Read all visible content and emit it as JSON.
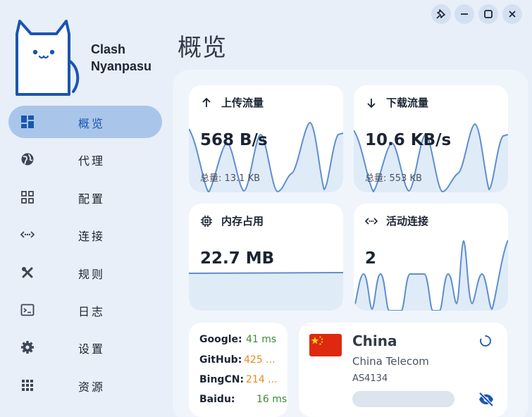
{
  "app": {
    "name_line1": "Clash",
    "name_line2": "Nyanpasu"
  },
  "page_title": "概览",
  "sidebar": {
    "items": [
      {
        "label": "概览",
        "icon": "dashboard-icon",
        "active": true
      },
      {
        "label": "代理",
        "icon": "globe-icon",
        "active": false
      },
      {
        "label": "配置",
        "icon": "grid-icon",
        "active": false
      },
      {
        "label": "连接",
        "icon": "connection-arrows-icon",
        "active": false
      },
      {
        "label": "规则",
        "icon": "tools-icon",
        "active": false
      },
      {
        "label": "日志",
        "icon": "terminal-icon",
        "active": false
      },
      {
        "label": "设置",
        "icon": "gear-icon",
        "active": false
      },
      {
        "label": "资源",
        "icon": "apps-icon",
        "active": false
      }
    ]
  },
  "window_controls": [
    "pin-icon",
    "minimize-icon",
    "maximize-icon",
    "close-icon"
  ],
  "cards": {
    "upload": {
      "title": "上传流量",
      "value": "568 B/s",
      "total": "总量: 13.1 KB"
    },
    "download": {
      "title": "下载流量",
      "value": "10.6 KB/s",
      "total": "总量: 553 KB"
    },
    "memory": {
      "title": "内存占用",
      "value": "22.7 MB"
    },
    "connections": {
      "title": "活动连接",
      "value": "2"
    }
  },
  "latency": [
    {
      "name": "Google:",
      "value": "41 ms",
      "color": "#3c8b36"
    },
    {
      "name": "GitHub:",
      "value": "425 ...",
      "color": "#e8891c"
    },
    {
      "name": "BingCN:",
      "value": "214 ...",
      "color": "#e8891c"
    },
    {
      "name": "Baidu:",
      "value": "16 ms",
      "color": "#3c8b36"
    }
  ],
  "ip_info": {
    "country": "China",
    "isp": "China Telecom",
    "asn": "AS4134"
  },
  "colors": {
    "accent": "#1a56b0",
    "active_nav_bg": "#a9c6ea",
    "chart_line": "#5c8fd0",
    "chart_fill": "#e0ebf8",
    "flag_red": "#de2910",
    "flag_yellow": "#ffde00"
  }
}
